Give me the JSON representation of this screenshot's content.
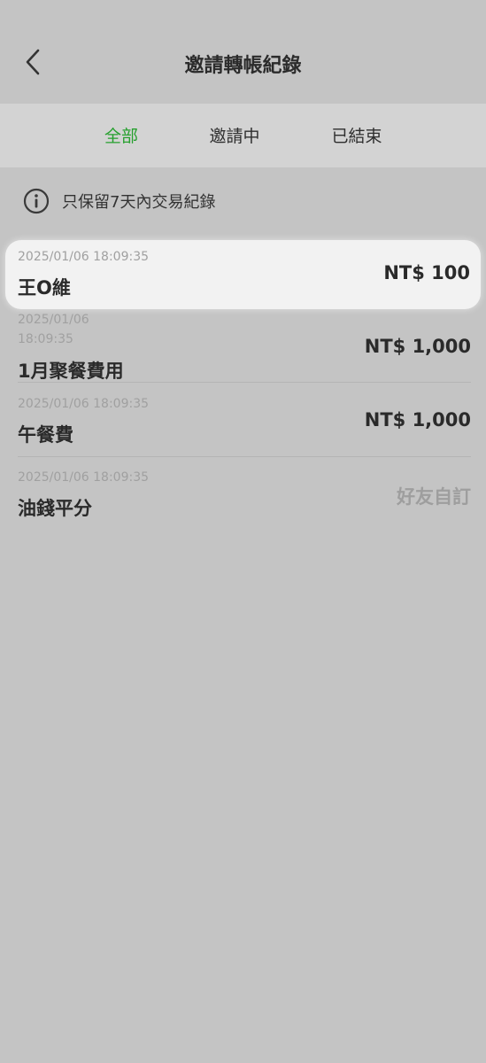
{
  "header": {
    "title": "邀請轉帳紀錄",
    "back_icon": "chevron-left-icon"
  },
  "tabs": [
    {
      "label": "全部",
      "active": true
    },
    {
      "label": "邀請中",
      "active": false
    },
    {
      "label": "已結束",
      "active": false
    }
  ],
  "notice": {
    "icon": "info-icon",
    "text": "只保留7天內交易紀錄"
  },
  "records": [
    {
      "time": "2025/01/06 18:09:35",
      "name": "王O維",
      "amount": "NT$ 100",
      "status": ""
    },
    {
      "time_line1": "2025/01/06",
      "time_line2": "18:09:35",
      "name": "1月聚餐費用",
      "amount": "NT$ 1,000",
      "status": ""
    },
    {
      "time": "2025/01/06 18:09:35",
      "name": "午餐費",
      "amount": "NT$ 1,000",
      "status": ""
    },
    {
      "time": "2025/01/06 18:09:35",
      "name": "油錢平分",
      "amount": "",
      "status": "好友自訂"
    }
  ],
  "colors": {
    "active_tab": "#26a02e",
    "background": "#c4c4c4",
    "highlight": "#f2f2f2"
  }
}
